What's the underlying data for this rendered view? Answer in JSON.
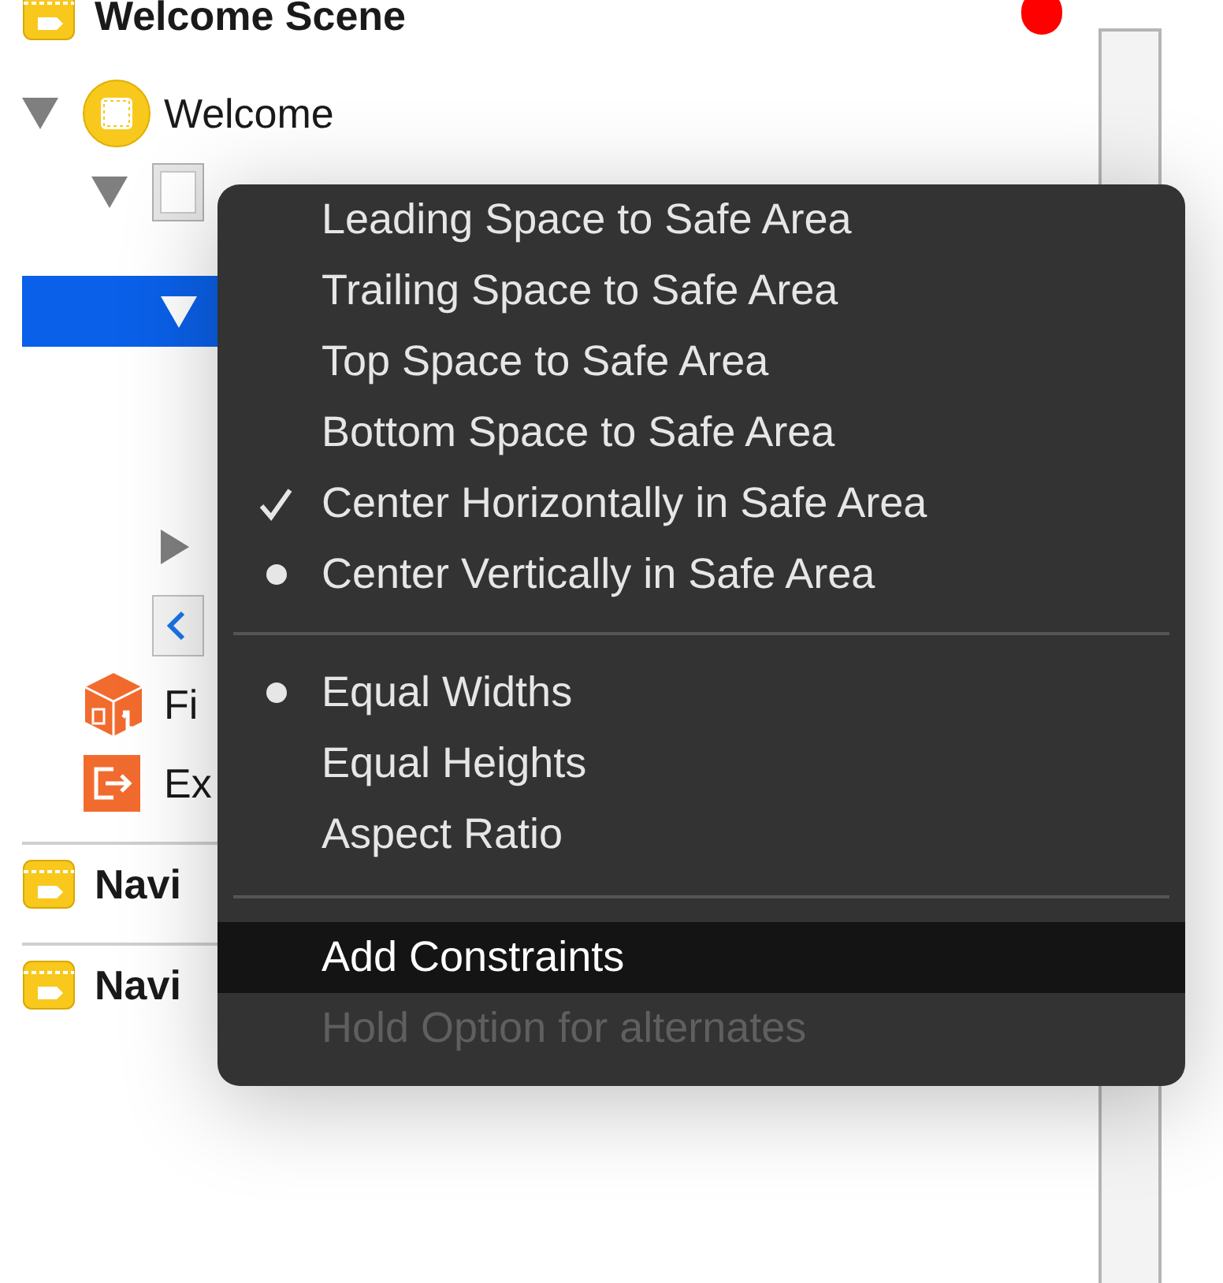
{
  "outline": {
    "rows": [
      {
        "kind": "scene",
        "label": "Welcome Scene",
        "children": [
          {
            "kind": "controller",
            "label": "Welcome",
            "expanded": true,
            "selected": false,
            "children": [
              {
                "kind": "view",
                "expanded": true,
                "selected": false,
                "children": [
                  {
                    "kind": "container",
                    "expanded": true,
                    "selected": true
                  },
                  {
                    "kind": "constraints",
                    "expanded": false,
                    "selected": false
                  }
                ]
              },
              {
                "kind": "back",
                "selected": false
              }
            ]
          },
          {
            "kind": "responder",
            "label": "Fi",
            "selected": false
          },
          {
            "kind": "exit",
            "label": "Ex",
            "selected": false
          }
        ]
      },
      {
        "kind": "scene",
        "label": "Navi"
      },
      {
        "kind": "scene",
        "label": "Navi"
      }
    ]
  },
  "menu": {
    "sections": [
      [
        {
          "label": "Leading Space to Safe Area",
          "checked": false,
          "mixed": false,
          "selected": false,
          "disabled": false
        },
        {
          "label": "Trailing Space to Safe Area",
          "checked": false,
          "mixed": false,
          "selected": false,
          "disabled": false
        },
        {
          "label": "Top Space to Safe Area",
          "checked": false,
          "mixed": false,
          "selected": false,
          "disabled": false
        },
        {
          "label": "Bottom Space to Safe Area",
          "checked": false,
          "mixed": false,
          "selected": false,
          "disabled": false
        },
        {
          "label": "Center Horizontally in Safe Area",
          "checked": true,
          "mixed": false,
          "selected": false,
          "disabled": false
        },
        {
          "label": "Center Vertically in Safe Area",
          "checked": false,
          "mixed": true,
          "selected": false,
          "disabled": false
        }
      ],
      [
        {
          "label": "Equal Widths",
          "checked": false,
          "mixed": true,
          "selected": false,
          "disabled": false
        },
        {
          "label": "Equal Heights",
          "checked": false,
          "mixed": false,
          "selected": false,
          "disabled": false
        },
        {
          "label": "Aspect Ratio",
          "checked": false,
          "mixed": false,
          "selected": false,
          "disabled": false
        }
      ],
      [
        {
          "label": "Add Constraints",
          "checked": false,
          "mixed": false,
          "selected": true,
          "disabled": false
        },
        {
          "label": "Hold Option for alternates",
          "checked": false,
          "mixed": false,
          "selected": false,
          "disabled": true
        }
      ]
    ]
  }
}
